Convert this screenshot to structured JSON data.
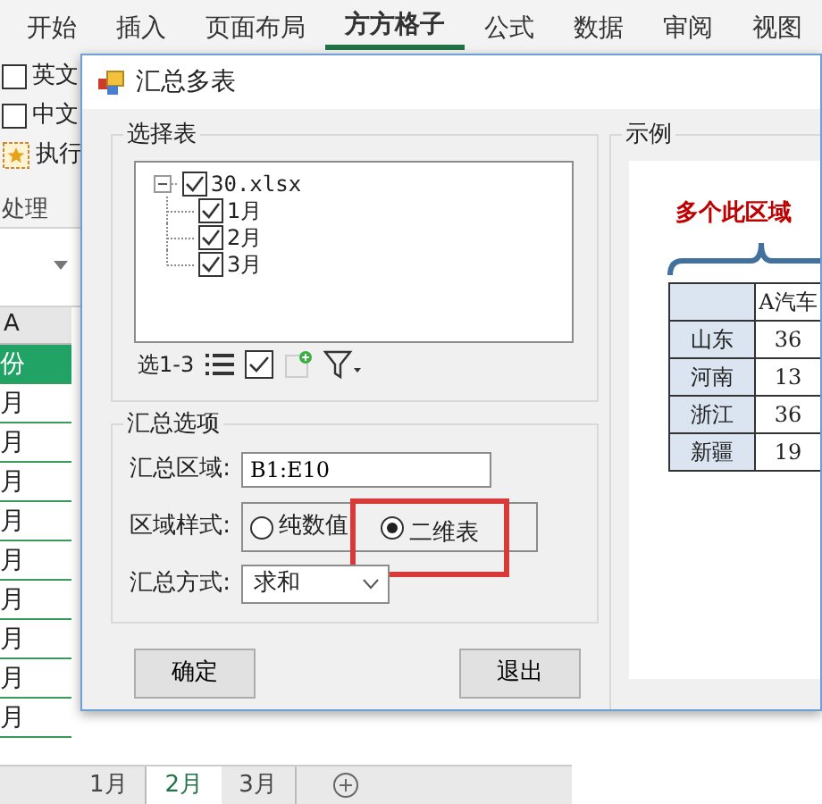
{
  "ribbon": {
    "tabs": [
      {
        "label": "开始",
        "selected": false
      },
      {
        "label": "插入",
        "selected": false
      },
      {
        "label": "页面布局",
        "selected": false
      },
      {
        "label": "方方格子",
        "selected": true
      },
      {
        "label": "公式",
        "selected": false
      },
      {
        "label": "数据",
        "selected": false
      },
      {
        "label": "审阅",
        "selected": false
      },
      {
        "label": "视图",
        "selected": false
      }
    ],
    "items": [
      {
        "kind": "checkbox",
        "label": "英文",
        "checked": false
      },
      {
        "kind": "checkbox",
        "label": "中文",
        "checked": false
      },
      {
        "kind": "button",
        "label": "执行"
      }
    ],
    "group_label": "处理"
  },
  "sheet": {
    "column_header": "A",
    "cells": [
      {
        "text": "份",
        "header": true
      },
      {
        "text": "月",
        "header": false
      },
      {
        "text": "月",
        "header": false
      },
      {
        "text": "月",
        "header": false
      },
      {
        "text": "月",
        "header": false
      },
      {
        "text": "月",
        "header": false
      },
      {
        "text": "月",
        "header": false
      },
      {
        "text": "月",
        "header": false
      },
      {
        "text": "月",
        "header": false
      },
      {
        "text": "月",
        "header": false
      }
    ]
  },
  "sheet_tabs": [
    {
      "label": "1月",
      "selected": false
    },
    {
      "label": "2月",
      "selected": true
    },
    {
      "label": "3月",
      "selected": false
    }
  ],
  "dialog": {
    "title": "汇总多表",
    "select_group": {
      "title": "选择表",
      "tree": [
        {
          "label": "30.xlsx",
          "checked": true,
          "expanded": true,
          "children": [
            {
              "label": "1月",
              "checked": true
            },
            {
              "label": "2月",
              "checked": true
            },
            {
              "label": "3月",
              "checked": true
            }
          ]
        }
      ],
      "toolbar_label": "选1-3"
    },
    "options_group": {
      "title": "汇总选项",
      "fields": [
        {
          "kind": "text",
          "label": "汇总区域:",
          "value": "B1:E10"
        },
        {
          "kind": "radio",
          "label": "区域样式:",
          "options": [
            {
              "label": "纯数值",
              "selected": false,
              "highlighted": false
            },
            {
              "label": "二维表",
              "selected": true,
              "highlighted": true
            }
          ]
        },
        {
          "kind": "select",
          "label": "汇总方式:",
          "value": "求和"
        }
      ]
    },
    "buttons": [
      "确定",
      "退出"
    ],
    "example": {
      "title": "示例",
      "caption": "多个此区域",
      "table": {
        "columns": [
          "",
          "A汽车"
        ],
        "rows": [
          [
            "山东",
            "36"
          ],
          [
            "河南",
            "13"
          ],
          [
            "浙江",
            "36"
          ],
          [
            "新疆",
            "19"
          ]
        ]
      }
    }
  }
}
